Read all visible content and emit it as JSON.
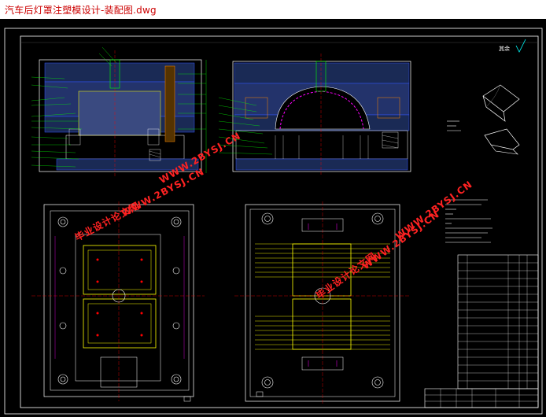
{
  "window": {
    "title": "汽车后灯罩注塑模设计-装配图.dwg"
  },
  "watermarks": [
    {
      "kind": "cn",
      "text": "毕业设计论文网"
    },
    {
      "kind": "site",
      "text": "WWW.2BYSJ.CN"
    },
    {
      "kind": "site",
      "text": "WWW.2BYSJ.CN"
    },
    {
      "kind": "cn",
      "text": "毕业设计论文网"
    },
    {
      "kind": "site",
      "text": "WWW.2BYSJ.CN"
    },
    {
      "kind": "site",
      "text": "WWW.2BYSJ.CN"
    }
  ],
  "drawing": {
    "corner_mark": "其余",
    "colors": {
      "background": "#000000",
      "frame": "#ffffff",
      "cyan": "#00ffff",
      "green": "#00ff00",
      "yellow": "#ffff00",
      "red": "#ff0000",
      "magenta": "#ff00ff",
      "blue": "#3355ff"
    }
  }
}
